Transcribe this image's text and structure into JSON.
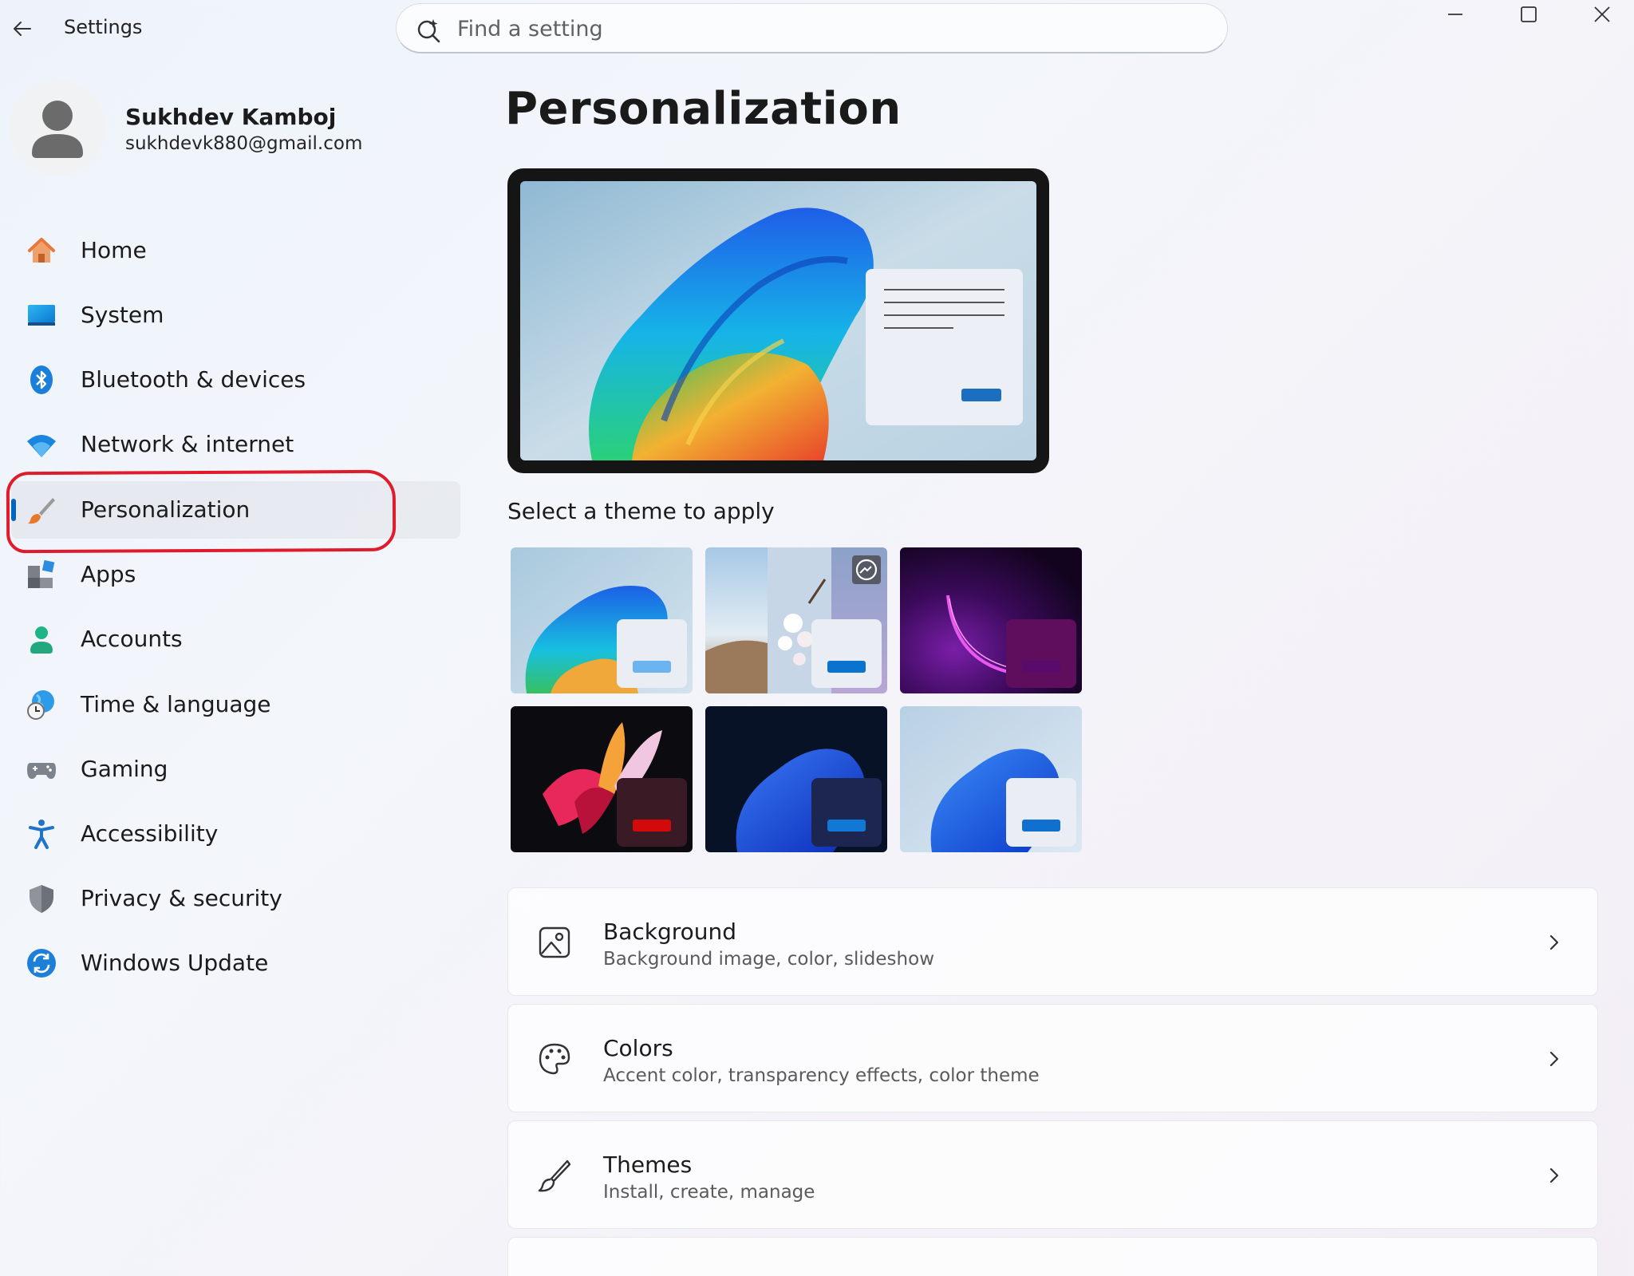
{
  "app": {
    "title": "Settings"
  },
  "search": {
    "placeholder": "Find a setting"
  },
  "profile": {
    "name": "Sukhdev Kamboj",
    "email": "sukhdevk880@gmail.com"
  },
  "sidebar": {
    "selected": "Personalization",
    "items": [
      {
        "label": "Home",
        "icon": "home-icon"
      },
      {
        "label": "System",
        "icon": "system-icon"
      },
      {
        "label": "Bluetooth & devices",
        "icon": "bluetooth-icon"
      },
      {
        "label": "Network & internet",
        "icon": "wifi-icon"
      },
      {
        "label": "Personalization",
        "icon": "paintbrush-icon"
      },
      {
        "label": "Apps",
        "icon": "apps-icon"
      },
      {
        "label": "Accounts",
        "icon": "accounts-icon"
      },
      {
        "label": "Time & language",
        "icon": "globe-clock-icon"
      },
      {
        "label": "Gaming",
        "icon": "gamepad-icon"
      },
      {
        "label": "Accessibility",
        "icon": "accessibility-icon"
      },
      {
        "label": "Privacy & security",
        "icon": "shield-icon"
      },
      {
        "label": "Windows Update",
        "icon": "update-icon"
      }
    ]
  },
  "main": {
    "title": "Personalization",
    "theme_section_label": "Select a theme to apply",
    "themes": [
      {
        "name": "windows-light",
        "accent": "#6cb4f0"
      },
      {
        "name": "spotlight",
        "accent": "#0a73d0"
      },
      {
        "name": "glow",
        "accent": "#5a0a6a"
      },
      {
        "name": "captured-motion",
        "accent": "#d20a0a"
      },
      {
        "name": "windows-dark",
        "accent": "#1278d6"
      },
      {
        "name": "flow",
        "accent": "#0f70cf"
      }
    ],
    "cards": [
      {
        "title": "Background",
        "subtitle": "Background image, color, slideshow",
        "icon": "image-icon"
      },
      {
        "title": "Colors",
        "subtitle": "Accent color, transparency effects, color theme",
        "icon": "palette-icon"
      },
      {
        "title": "Themes",
        "subtitle": "Install, create, manage",
        "icon": "brush-icon"
      }
    ]
  },
  "colors": {
    "accent": "#0067c0",
    "highlight_ring": "#e01b2b"
  }
}
